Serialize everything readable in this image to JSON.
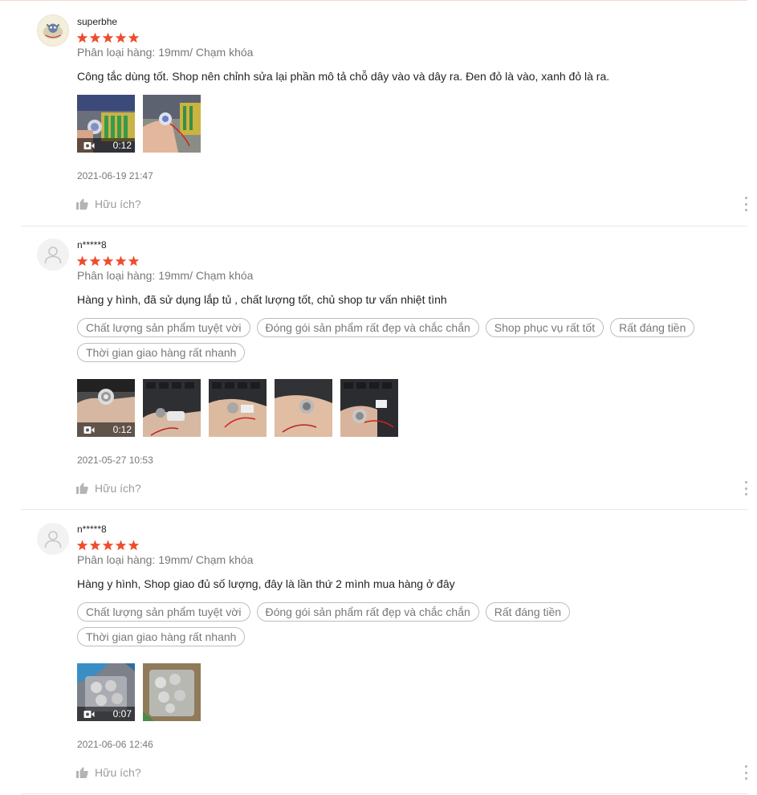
{
  "colors": {
    "star": "#ee4d2d",
    "tag_border": "rgba(0,0,0,0.26)",
    "muted_text": "rgba(0,0,0,0.54)"
  },
  "icons": {
    "star": "star-icon",
    "helpful": "thumbs-up-icon",
    "video": "video-camera-icon",
    "more": "more-vertical-icon",
    "avatar": "user-placeholder-icon"
  },
  "reviews": [
    {
      "username": "superbhe",
      "rating": 5,
      "variation": "Phân loại hàng: 19mm/ Chạm khóa",
      "comment": "Công tắc dùng tốt. Shop nên chỉnh sửa lại phần mô tả chỗ dây vào và dây ra. Đen đỏ là vào, xanh đỏ là ra.",
      "tags": [],
      "video_duration": "0:12",
      "date": "2021-06-19 21:47",
      "helpful_label": "Hữu ích?"
    },
    {
      "username": "n*****8",
      "rating": 5,
      "variation": "Phân loại hàng: 19mm/ Chạm khóa",
      "comment": "Hàng y hình, đã sử dụng lắp tủ , chất lượng tốt, chủ shop tư vấn nhiệt tình",
      "tags": [
        "Chất lượng sản phẩm tuyệt vời",
        "Đóng gói sản phẩm rất đẹp và chắc chắn",
        "Shop phục vụ rất tốt",
        "Rất đáng tiền",
        "Thời gian giao hàng rất nhanh"
      ],
      "video_duration": "0:12",
      "date": "2021-05-27 10:53",
      "helpful_label": "Hữu ích?"
    },
    {
      "username": "n*****8",
      "rating": 5,
      "variation": "Phân loại hàng: 19mm/ Chạm khóa",
      "comment": "Hàng y hình, Shop giao đủ số lượng, đây là lần thứ 2 mình mua hàng ở đây",
      "tags": [
        "Chất lượng sản phẩm tuyệt vời",
        "Đóng gói sản phẩm rất đẹp và chắc chắn",
        "Rất đáng tiền",
        "Thời gian giao hàng rất nhanh"
      ],
      "video_duration": "0:07",
      "date": "2021-06-06 12:46",
      "helpful_label": "Hữu ích?"
    }
  ]
}
